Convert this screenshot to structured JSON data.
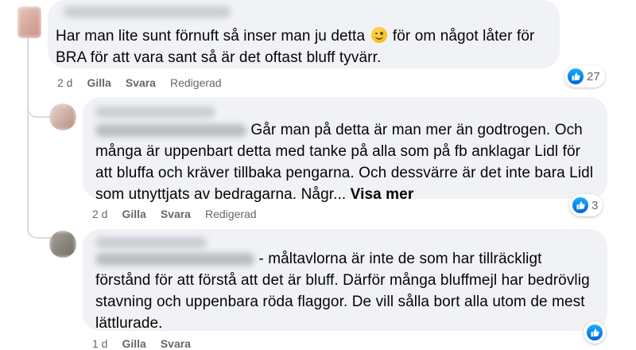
{
  "comments": [
    {
      "text_before_emoji": "Har man lite sunt förnuft så inser man ju detta",
      "text_after_emoji": " för om något låter för BRA för att vara sant så är det oftast bluff tyvärr.",
      "emoji": "smirk-emoji",
      "time": "2 d",
      "like_label": "Gilla",
      "reply_label": "Svara",
      "edited_label": "Redigerad",
      "reaction_count": "27"
    },
    {
      "text": "Går man på detta är man mer än godtrogen. Och många är uppenbart detta med tanke på alla som på fb anklagar Lidl för att bluffa och kräver tillbaka pengarna. Och dessvärre är det inte bara Lidl som utnyttjats av bedragarna. Någr...",
      "see_more": "Visa mer",
      "time": "2 d",
      "like_label": "Gilla",
      "reply_label": "Svara",
      "edited_label": "Redigerad",
      "reaction_count": "3"
    },
    {
      "text": "- måltavlorna är inte de som har tillräckligt förstånd för att förstå att det är bluff. Därför många bluffmejl har bedrövlig stavning och uppenbara röda flaggor. De vill sålla bort alla utom de mest lättlurade.",
      "time": "1 d",
      "like_label": "Gilla",
      "reply_label": "Svara"
    }
  ],
  "colors": {
    "bubble": "#f0f2f5",
    "meta_text": "#65676b",
    "like_blue": "#0866ff"
  }
}
